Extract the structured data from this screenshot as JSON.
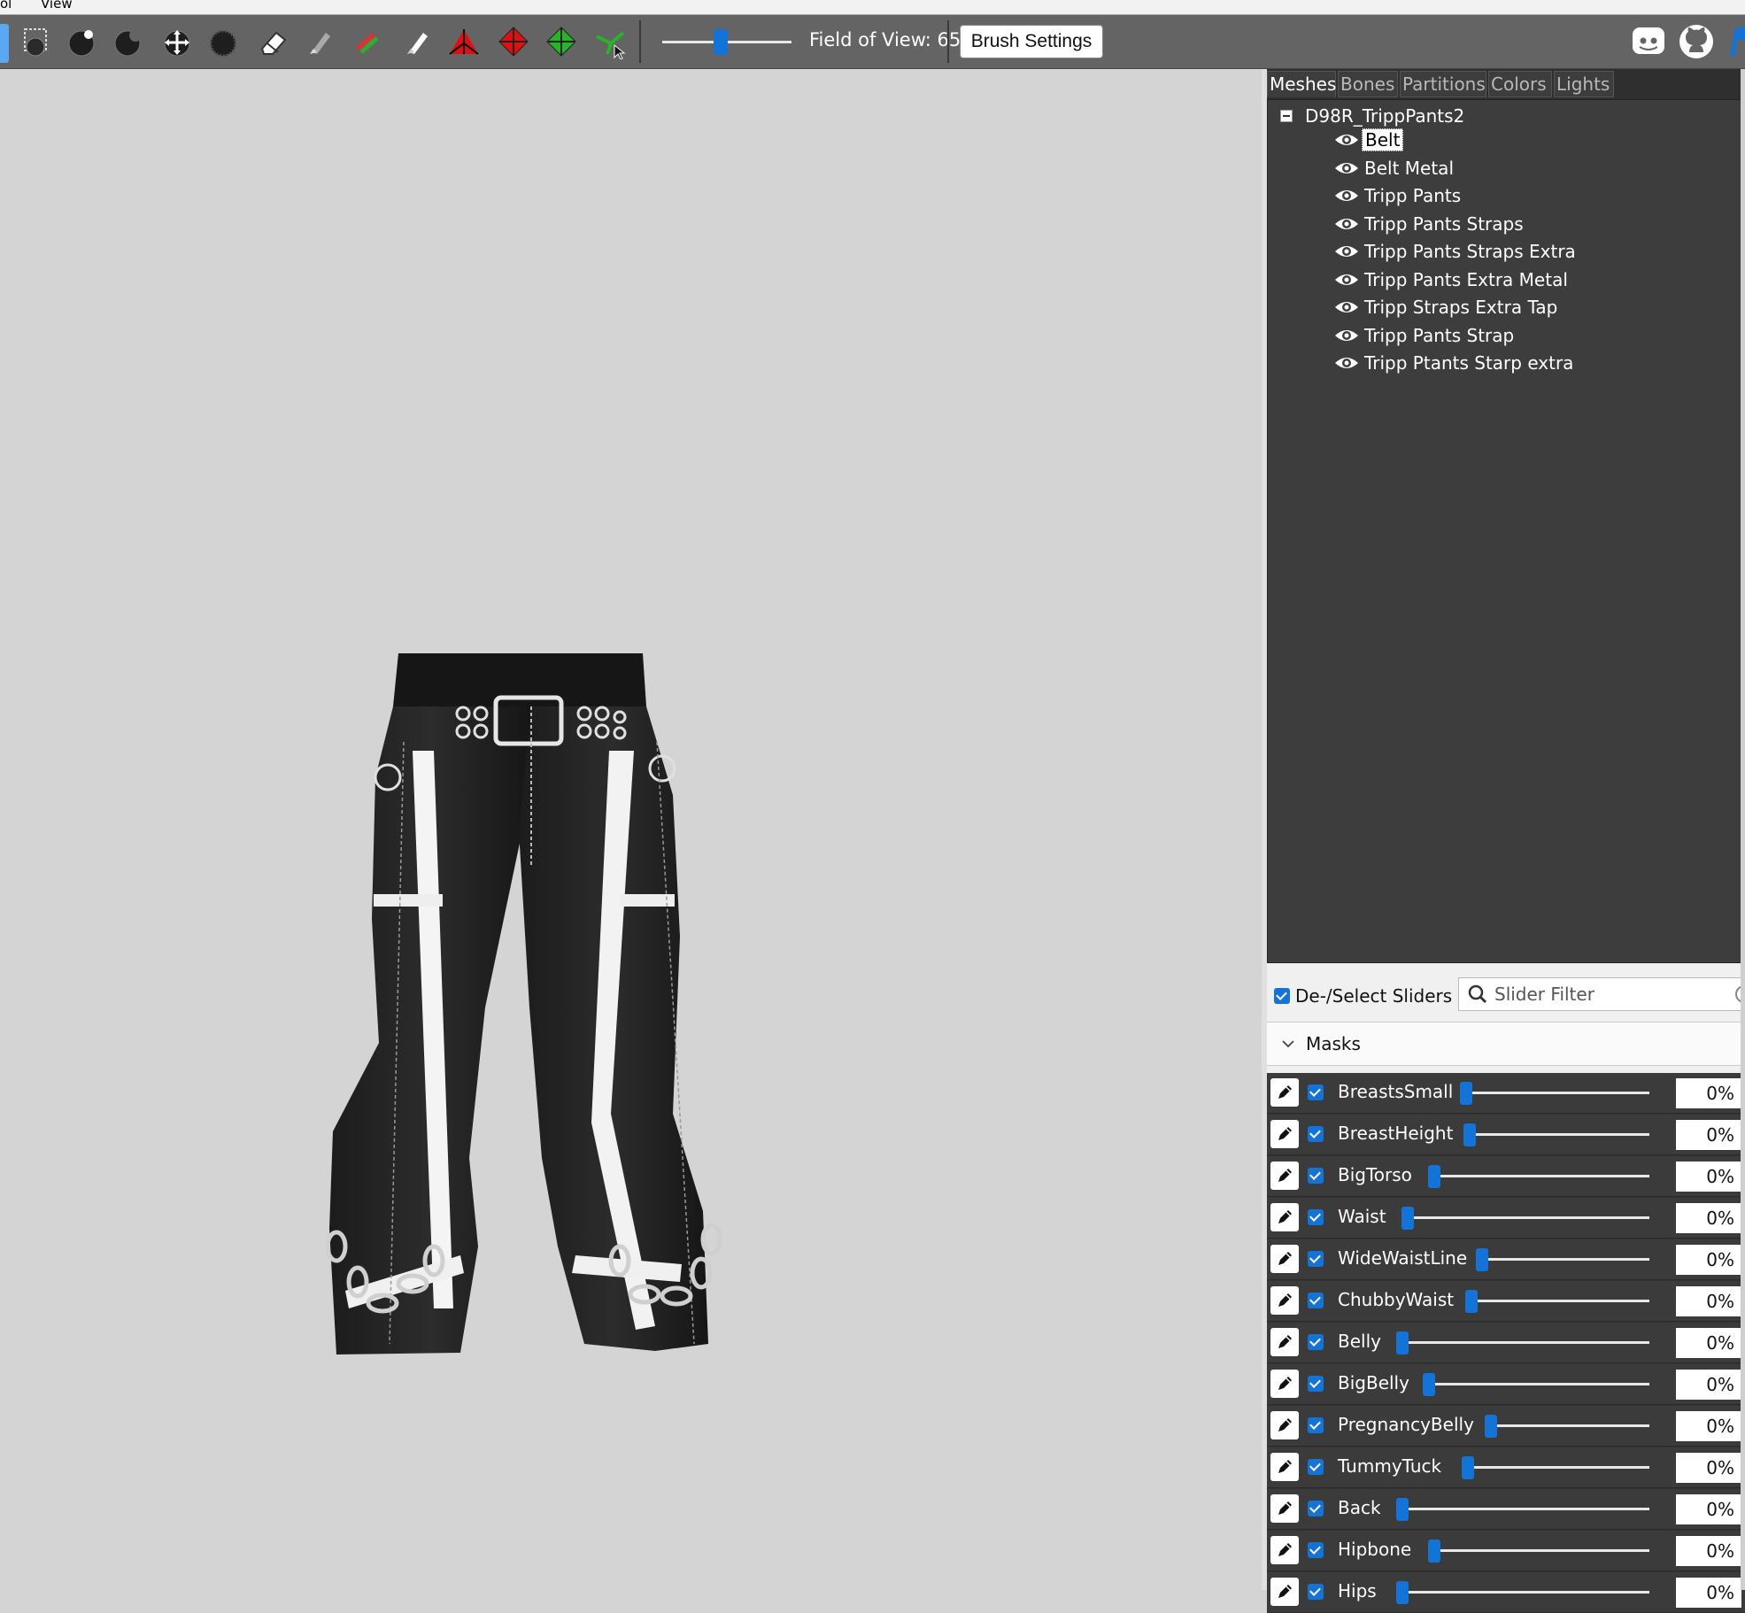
{
  "menubar": {
    "items": [
      "ol",
      "View"
    ]
  },
  "toolbar": {
    "fov_label": "Field of View: 65",
    "fov_value": 65,
    "brush_settings_label": "Brush Settings",
    "tools": [
      "select-tool-icon",
      "inflate-brush-icon",
      "deflate-brush-icon",
      "move-brush-icon",
      "smooth-brush-icon",
      "mask-brush-icon",
      "undiff-brush-icon",
      "weight-brush-icon",
      "color-brush-icon",
      "alpha-brush-icon",
      "transform-tool-icon",
      "pivot-tool-icon",
      "vertex-select-icon",
      "collision-tool-icon"
    ]
  },
  "tabs": [
    "Meshes",
    "Bones",
    "Partitions",
    "Colors",
    "Lights"
  ],
  "tree": {
    "root": "D98R_TrippPants2",
    "items": [
      {
        "label": "Belt",
        "selected": true
      },
      {
        "label": "Belt Metal"
      },
      {
        "label": "Tripp Pants"
      },
      {
        "label": "Tripp Pants Straps"
      },
      {
        "label": "Tripp Pants Straps Extra"
      },
      {
        "label": "Tripp Pants Extra Metal"
      },
      {
        "label": "Tripp Straps Extra Tap"
      },
      {
        "label": "Tripp Pants Strap"
      },
      {
        "label": "Tripp Ptants Starp extra"
      }
    ]
  },
  "slider_panel": {
    "deselect_label": "De-/Select Sliders",
    "filter_placeholder": "Slider Filter",
    "group_label": "Masks",
    "sliders": [
      {
        "name": "BreastsSmall",
        "value": "0%",
        "level": 0
      },
      {
        "name": "BreastHeight",
        "value": "0%",
        "level": 0
      },
      {
        "name": "BigTorso",
        "value": "0%",
        "level": 0
      },
      {
        "name": "Waist",
        "value": "0%",
        "level": 0
      },
      {
        "name": "WideWaistLine",
        "value": "0%",
        "level": 0
      },
      {
        "name": "ChubbyWaist",
        "value": "0%",
        "level": 0
      },
      {
        "name": "Belly",
        "value": "0%",
        "level": 0
      },
      {
        "name": "BigBelly",
        "value": "0%",
        "level": 0
      },
      {
        "name": "PregnancyBelly",
        "value": "0%",
        "level": 0
      },
      {
        "name": "TummyTuck",
        "value": "0%",
        "level": 0
      },
      {
        "name": "Back",
        "value": "0%",
        "level": 0
      },
      {
        "name": "Hipbone",
        "value": "0%",
        "level": 0
      },
      {
        "name": "Hips",
        "value": "0%",
        "level": 0
      }
    ]
  },
  "colors": {
    "accent": "#1473d6",
    "panel_dark": "#3d3d3d",
    "toolbar": "#646464",
    "viewport": "#d4d4d4"
  }
}
